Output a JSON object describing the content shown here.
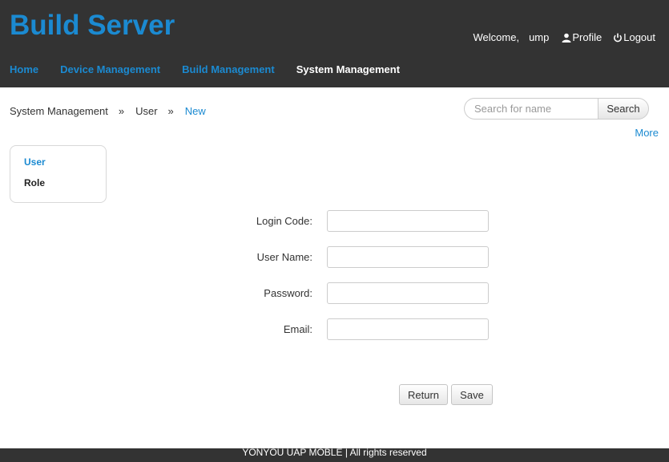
{
  "header": {
    "brand": "Build Server",
    "welcome": "Welcome,",
    "username": "ump",
    "profile_label": "Profile",
    "logout_label": "Logout"
  },
  "nav": {
    "items": [
      {
        "label": "Home",
        "active": false
      },
      {
        "label": "Device Management",
        "active": false
      },
      {
        "label": "Build Management",
        "active": false
      },
      {
        "label": "System Management",
        "active": true
      }
    ]
  },
  "breadcrumb": {
    "items": [
      "System Management",
      "User",
      "New"
    ],
    "separator": "»"
  },
  "search": {
    "placeholder": "Search for name",
    "button_label": "Search"
  },
  "more_label": "More",
  "sidebar": {
    "items": [
      {
        "label": "User",
        "active": true
      },
      {
        "label": "Role",
        "active": false
      }
    ]
  },
  "form": {
    "fields": [
      {
        "label": "Login Code:",
        "value": ""
      },
      {
        "label": "User Name:",
        "value": ""
      },
      {
        "label": "Password:",
        "value": ""
      },
      {
        "label": "Email:",
        "value": ""
      }
    ],
    "return_label": "Return",
    "save_label": "Save"
  },
  "footer": {
    "text": "YONYOU UAP MOBLE | All rights reserved"
  },
  "colors": {
    "accent": "#1b8ad1",
    "header_bg": "#333333"
  }
}
